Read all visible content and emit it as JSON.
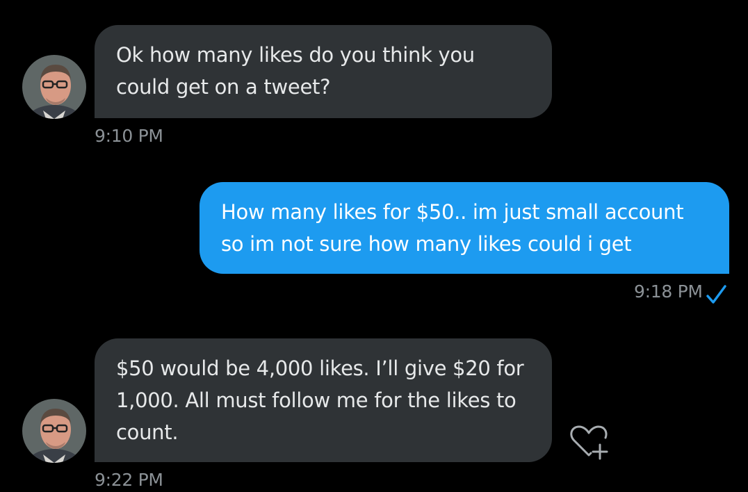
{
  "conversation": {
    "messages": [
      {
        "direction": "received",
        "text": "Ok how many likes do you think you could get on a tweet?",
        "time": "9:10 PM"
      },
      {
        "direction": "sent",
        "text": "How many likes for $50.. im just small account so im not sure how many likes could i get",
        "time": "9:18 PM",
        "status_icon": "checkmark-icon"
      },
      {
        "direction": "received",
        "text": "$50 would be 4,000 likes. I’ll give $20 for 1,000. All must follow me for the likes to count.",
        "time": "9:22 PM",
        "reaction_icon": "heart-plus-icon"
      }
    ]
  },
  "colors": {
    "background": "#000000",
    "received_bubble": "#2f3336",
    "sent_bubble": "#1d9bf0",
    "timestamp": "#8b9196",
    "check": "#1d9bf0"
  }
}
